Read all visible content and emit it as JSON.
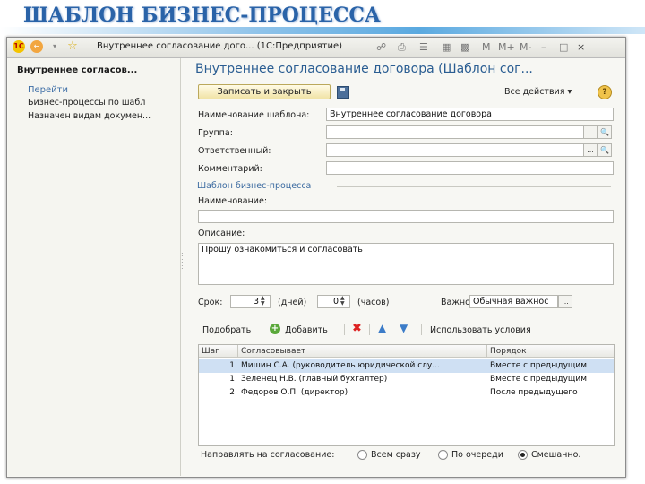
{
  "slide_title": "ШАБЛОН БИЗНЕС-ПРОЦЕССА",
  "window": {
    "title": "Внутреннее согласование дого... (1С:Предприятие)",
    "controls": [
      "M",
      "M+",
      "M-",
      "–",
      "□",
      "×"
    ]
  },
  "left_panel": {
    "header": "Внутреннее согласов...",
    "goto_label": "Перейти",
    "links": [
      "Бизнес-процессы по шабл",
      "Назначен видам докумен..."
    ]
  },
  "form": {
    "title": "Внутреннее согласование договора (Шаблон сог...",
    "save_close_label": "Записать и закрыть",
    "all_actions_label": "Все действия ▾",
    "help_label": "?",
    "fields": {
      "template_name": {
        "label": "Наименование шаблона:",
        "value": "Внутреннее согласование договора"
      },
      "group": {
        "label": "Группа:",
        "value": ""
      },
      "responsible": {
        "label": "Ответственный:",
        "value": ""
      },
      "comment": {
        "label": "Комментарий:",
        "value": ""
      }
    },
    "bp_group_label": "Шаблон бизнес-процесса",
    "name_label": "Наименование:",
    "name_value": "",
    "description_label": "Описание:",
    "description_value": "Прошу ознакомиться и согласовать",
    "deadline": {
      "label": "Срок:",
      "days_value": "3",
      "days_unit": "(дней)",
      "hours_value": "0",
      "hours_unit": "(часов)",
      "importance_label": "Важность:",
      "importance_value": "Обычная важнос"
    },
    "table_toolbar": {
      "pick_label": "Подобрать",
      "add_label": "Добавить",
      "use_conditions_label": "Использовать условия"
    },
    "table": {
      "columns": [
        "Шаг",
        "Согласовывает",
        "Порядок"
      ],
      "rows": [
        {
          "step": "1",
          "who": "Мишин С.А. (руководитель юридической слу...",
          "order": "Вместе с предыдущим"
        },
        {
          "step": "1",
          "who": "Зеленец Н.В. (главный бухгалтер)",
          "order": "Вместе с предыдущим"
        },
        {
          "step": "2",
          "who": "Федоров О.П. (директор)",
          "order": "После предыдущего"
        }
      ]
    },
    "routing": {
      "label": "Направлять на согласование:",
      "options": [
        "Всем сразу",
        "По очереди",
        "Смешанно."
      ],
      "selected": 2
    }
  }
}
